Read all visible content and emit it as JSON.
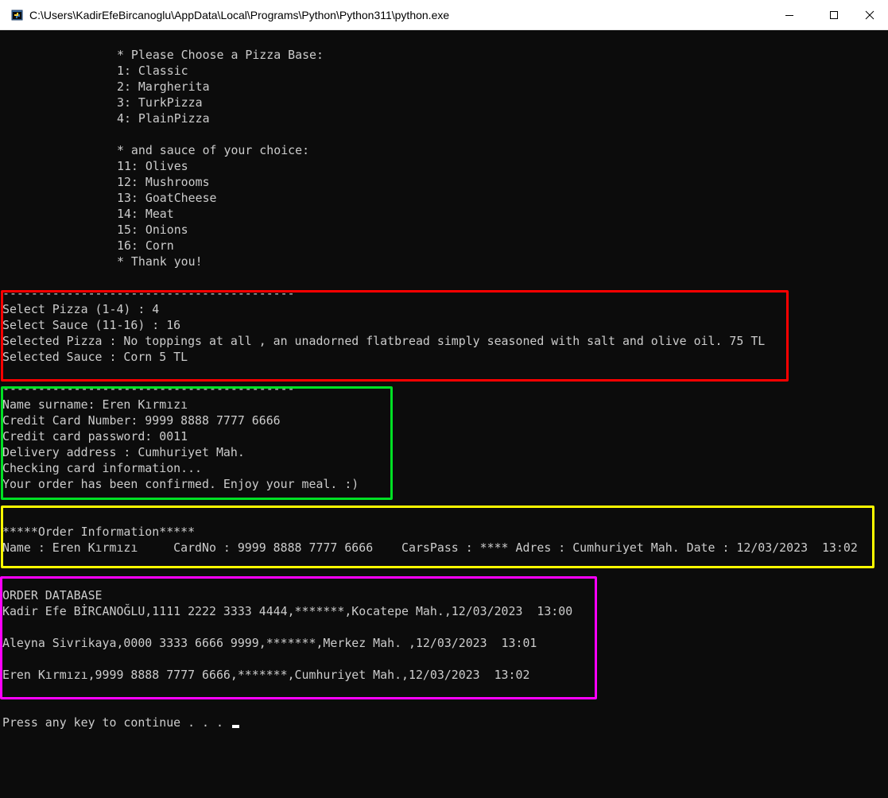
{
  "window": {
    "title": "C:\\Users\\KadirEfeBircanoglu\\AppData\\Local\\Programs\\Python\\Python311\\python.exe",
    "icon": "python-console-icon"
  },
  "controls": {
    "minimize_icon": "minimize-icon",
    "maximize_icon": "maximize-icon",
    "close_icon": "close-icon"
  },
  "menu": {
    "base_header": "* Please Choose a Pizza Base:",
    "bases": [
      "1: Classic",
      "2: Margherita",
      "3: TurkPizza",
      "4: PlainPizza"
    ],
    "sauce_header": "* and sauce of your choice:",
    "sauces": [
      "11: Olives",
      "12: Mushrooms",
      "13: GoatCheese",
      "14: Meat",
      "15: Onions",
      "16: Corn"
    ],
    "thanks": "* Thank you!"
  },
  "separator": "-----------------------------------------",
  "selection": {
    "select_pizza": "Select Pizza (1-4) : 4",
    "select_sauce": "Select Sauce (11-16) : 16",
    "selected_pizza": "Selected Pizza : No toppings at all , an unadorned flatbread simply seasoned with salt and olive oil. 75 TL",
    "selected_sauce": "Selected Sauce : Corn 5 TL"
  },
  "payment": {
    "name": "Name surname: Eren Kırmızı",
    "card_number": "Credit Card Number: 9999 8888 7777 6666",
    "card_password": "Credit card password: 0011",
    "address": "Delivery address : Cumhuriyet Mah.",
    "checking": "Checking card information...",
    "confirmed": "Your order has been confirmed. Enjoy your meal. :)"
  },
  "order_info": {
    "header": "*****Order Information*****",
    "summary": "Name : Eren Kırmızı     CardNo : 9999 8888 7777 6666    CarsPass : **** Adres : Cumhuriyet Mah. Date : 12/03/2023  13:02"
  },
  "database": {
    "header": "ORDER DATABASE",
    "rows": [
      "Kadir Efe BİRCANOĞLU,1111 2222 3333 4444,*******,Kocatepe Mah.,12/03/2023  13:00",
      "Aleyna Sivrikaya,0000 3333 6666 9999,*******,Merkez Mah. ,12/03/2023  13:01",
      "Eren Kırmızı,9999 8888 7777 6666,*******,Cumhuriyet Mah.,12/03/2023  13:02"
    ]
  },
  "prompt": "Press any key to continue . . .",
  "colors": {
    "console_bg": "#0c0c0c",
    "console_text": "#cccccc",
    "box_red": "#ff0000",
    "box_green": "#00e024",
    "box_yellow": "#ffff00",
    "box_magenta": "#ff00ff"
  }
}
